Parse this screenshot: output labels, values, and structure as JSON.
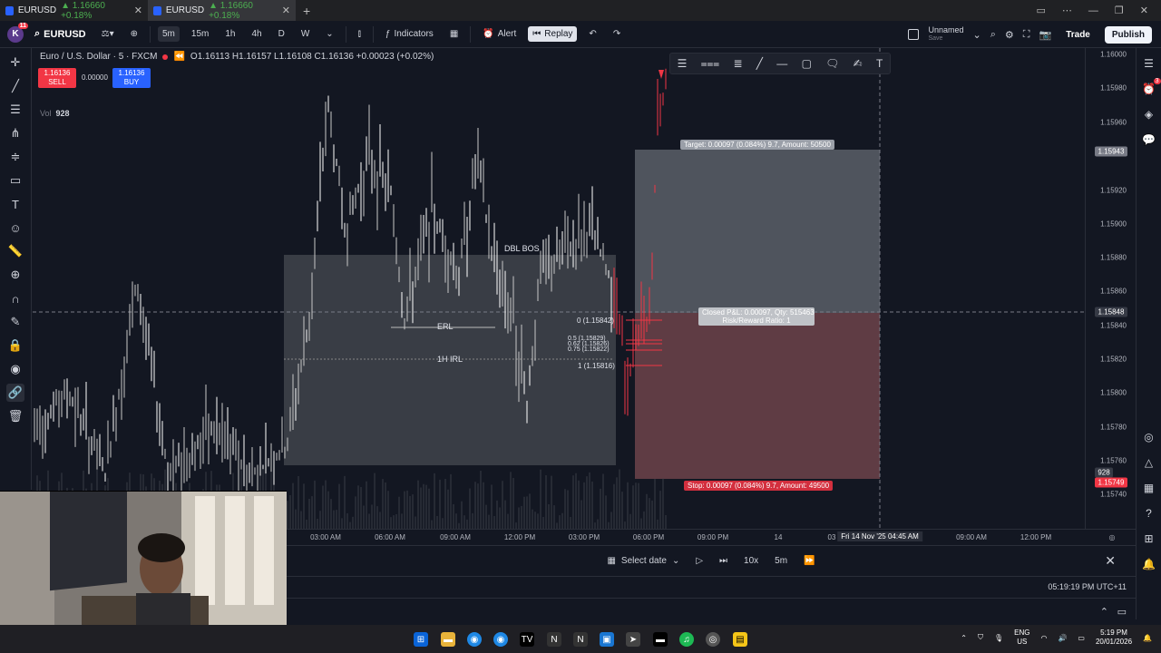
{
  "browser": {
    "tabs": [
      {
        "symbol": "EURUSD",
        "price": "1.16660",
        "change": "+0.18%",
        "active": false
      },
      {
        "symbol": "EURUSD",
        "price": "1.16660",
        "change": "+0.18%",
        "active": true
      }
    ],
    "new_tab": "+"
  },
  "toolbar": {
    "avatar": "K",
    "avatar_badge": "11",
    "symbol": "EURUSD",
    "timeframes": [
      "5m",
      "15m",
      "1h",
      "4h",
      "D",
      "W"
    ],
    "selected_timeframe": "5m",
    "indicators_label": "Indicators",
    "alert_label": "Alert",
    "replay_label": "Replay",
    "layout_name": "Unnamed",
    "layout_status": "Save",
    "trade_label": "Trade",
    "publish_label": "Publish"
  },
  "legend": {
    "instrument": "Euro / U.S. Dollar · 5 · FXCM",
    "ohlc": "O1.16113 H1.16157 L1.16108 C1.16136 +0.00023 (+0.02%)",
    "sell_price": "1.16136",
    "sell_label": "SELL",
    "spread": "0.00000",
    "buy_price": "1.16136",
    "buy_label": "BUY",
    "vol_label": "Vol",
    "vol_value": "928"
  },
  "chart_labels": {
    "target": "Target: 0.00097 (0.084%) 9.7, Amount: 50500",
    "stop": "Stop: 0.00097 (0.084%) 9.7, Amount: 49500",
    "closed_line1": "Closed P&L: 0.00097, Qty: 515463",
    "closed_line2": "Risk/Reward Ratio: 1",
    "dbl_bos": "DBL BOS",
    "erl": "ERL",
    "irl": "1H IRL",
    "fib_0": "0 (1.15842)",
    "fib_05": "0.5 (1.15829)",
    "fib_062": "0.62 (1.15826)",
    "fib_075": "0.75 (1.15822)",
    "fib_1": "1 (1.15816)"
  },
  "price_axis": {
    "ticks": [
      "1.16000",
      "1.15980",
      "1.15960",
      "1.15920",
      "1.15900",
      "1.15880",
      "1.15860",
      "1.15840",
      "1.15820",
      "1.15800",
      "1.15780",
      "1.15760",
      "1.15740"
    ],
    "target_marker": "1.15943",
    "crosshair_marker": "1.15848",
    "vol_marker": "928",
    "stop_marker": "1.15749"
  },
  "time_axis": {
    "ticks": [
      "03:00 AM",
      "06:00 AM",
      "09:00 AM",
      "12:00 PM",
      "03:00 PM",
      "06:00 PM",
      "09:00 PM",
      "14",
      "03",
      "09:00 AM",
      "12:00 PM"
    ],
    "crosshair": "Fri 14 Nov '25   04:45 AM"
  },
  "replay": {
    "select_date": "Select date",
    "speed": "10x",
    "interval": "5m"
  },
  "clock": "05:19:19 PM UTC+11",
  "taskbar": {
    "lang_top": "ENG",
    "lang_bottom": "US",
    "time": "5:19 PM",
    "date": "20/01/2026"
  },
  "colors": {
    "background": "#131722",
    "sell": "#f23645",
    "buy": "#2962ff",
    "target_zone": "#9aa0a6",
    "stop_zone": "#7a4a50"
  }
}
